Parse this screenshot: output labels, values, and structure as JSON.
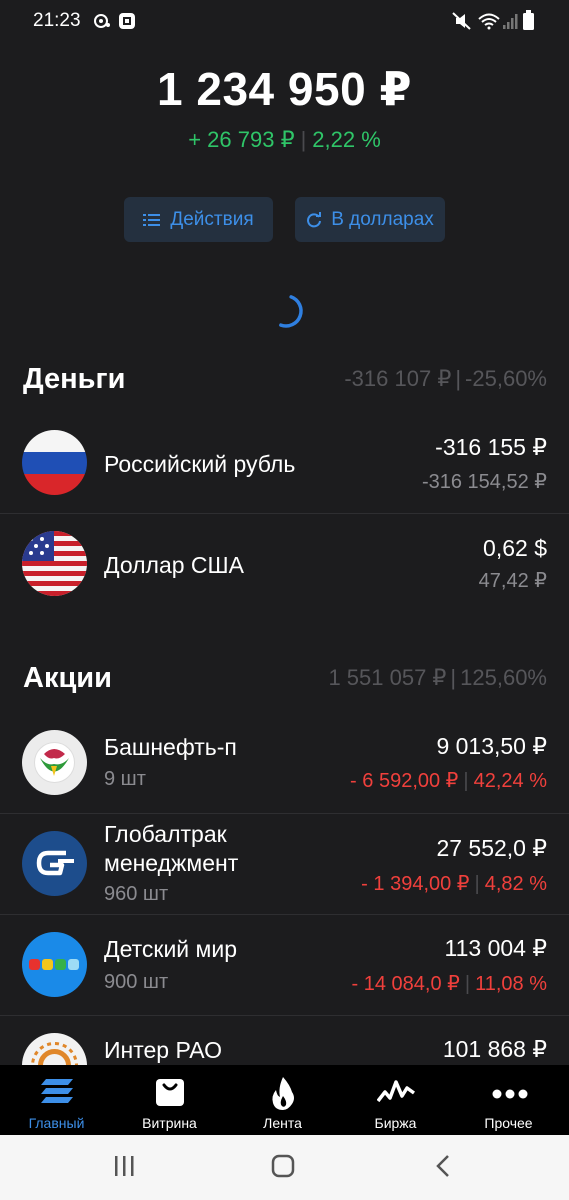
{
  "status_bar": {
    "time": "21:23",
    "icons": [
      "chat-bubble-icon",
      "screenshot-icon",
      "mute-icon",
      "wifi-icon",
      "signal-icon",
      "battery-icon"
    ]
  },
  "portfolio": {
    "total": "1 234 950 ₽",
    "change_abs": "+ 26 793 ₽",
    "change_pct": "2,22 %",
    "positive_color": "#2fc568"
  },
  "actions": {
    "actions_label": "Действия",
    "usd_label": "В долларах"
  },
  "money": {
    "title": "Деньги",
    "sum_abs": "-316 107 ₽",
    "sum_pct": "-25,60%",
    "items": [
      {
        "name": "Российский рубль",
        "value": "-316 155 ₽",
        "value2": "-316 154,52 ₽",
        "icon": "russia-flag-icon"
      },
      {
        "name": "Доллар США",
        "value": "0,62 $",
        "value2": "47,42 ₽",
        "icon": "usa-flag-icon"
      }
    ]
  },
  "stocks": {
    "title": "Акции",
    "sum_abs": "1 551 057 ₽",
    "sum_pct": "125,60%",
    "negative_color": "#f0403c",
    "items": [
      {
        "name": "Башнефть-п",
        "qty": "9 шт",
        "value": "9 013,50 ₽",
        "change_abs": "- 6 592,00 ₽",
        "change_pct": "42,24 %",
        "icon": "bashneft-logo-icon"
      },
      {
        "name_line1": "Глобалтрак",
        "name_line2": "менеджмент",
        "qty": "960 шт",
        "value": "27 552,0 ₽",
        "change_abs": "- 1 394,00 ₽",
        "change_pct": "4,82 %",
        "icon": "globaltrans-logo-icon"
      },
      {
        "name": "Детский мир",
        "qty": "900 шт",
        "value": "113 004 ₽",
        "change_abs": "- 14 084,0 ₽",
        "change_pct": "11,08 %",
        "icon": "detsky-mir-logo-icon"
      },
      {
        "name": "Интер РАО",
        "value": "101 868 ₽",
        "icon": "inter-rao-logo-icon"
      }
    ]
  },
  "tabbar": {
    "accent_color": "#3d8fe8",
    "tabs": [
      {
        "label": "Главный",
        "icon": "home-stack-icon",
        "active": true
      },
      {
        "label": "Витрина",
        "icon": "shopping-bag-icon"
      },
      {
        "label": "Лента",
        "icon": "flame-icon"
      },
      {
        "label": "Биржа",
        "icon": "chart-line-icon"
      },
      {
        "label": "Прочее",
        "icon": "more-dots-icon"
      }
    ]
  },
  "system_nav": {
    "icons": [
      "recent-apps-icon",
      "home-icon",
      "back-icon"
    ]
  }
}
